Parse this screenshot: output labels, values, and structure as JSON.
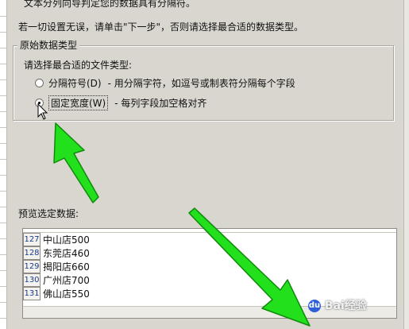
{
  "header": {
    "top_text": "文本分列向导判定您的数据具有分隔符。",
    "instruction": "若一切设置无误，请单击\"下一步\"，否则请选择最合适的数据类型。"
  },
  "data_type_group": {
    "title": "原始数据类型",
    "prompt": "请选择最合适的文件类型:",
    "options": [
      {
        "label": "分隔符号(D)",
        "description": "- 用分隔字符，如逗号或制表符分隔每个字段",
        "checked": false
      },
      {
        "label": "固定宽度(W)",
        "description": "- 每列字段加空格对齐",
        "checked": true
      }
    ]
  },
  "preview": {
    "label": "预览选定数据:",
    "rows": [
      {
        "num": "127",
        "text": "中山店500"
      },
      {
        "num": "128",
        "text": "东莞店460"
      },
      {
        "num": "129",
        "text": "揭阳店660"
      },
      {
        "num": "130",
        "text": "广州店700"
      },
      {
        "num": "131",
        "text": "佛山店550"
      }
    ]
  },
  "watermark": {
    "text": "Bai经验"
  },
  "colors": {
    "arrow": "#22e01c",
    "arrow_outline": "#0f8a0c",
    "dialog_bg": "#d9d6cf"
  }
}
